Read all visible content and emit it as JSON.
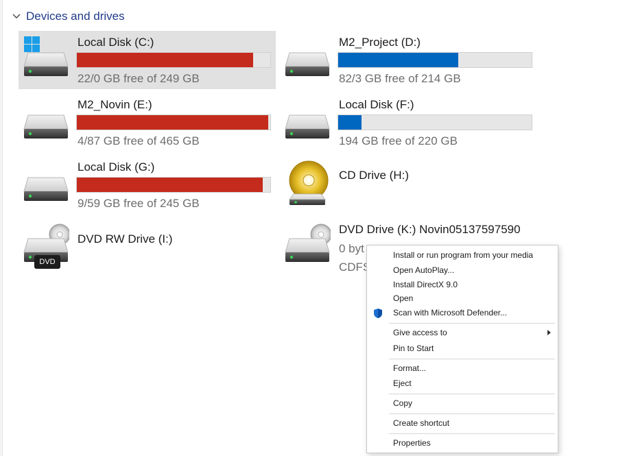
{
  "section": {
    "title": "Devices and drives",
    "chevron_icon": "chevron-down-icon"
  },
  "drives": [
    {
      "name": "Local Disk (C:)",
      "free_text": "22/0 GB free of 249 GB",
      "used_fraction": 0.91,
      "bar_color": "#c42b1c",
      "icon": "windows-drive-icon",
      "selected": true
    },
    {
      "name": "M2_Project (D:)",
      "free_text": "82/3 GB free of 214 GB",
      "used_fraction": 0.62,
      "bar_color": "#0067c0",
      "icon": "hard-drive-icon",
      "selected": false
    },
    {
      "name": "M2_Novin (E:)",
      "free_text": "4/87 GB free of 465 GB",
      "used_fraction": 0.99,
      "bar_color": "#c42b1c",
      "icon": "hard-drive-icon",
      "selected": false
    },
    {
      "name": "Local Disk (F:)",
      "free_text": "194 GB free of 220 GB",
      "used_fraction": 0.12,
      "bar_color": "#0067c0",
      "icon": "hard-drive-icon",
      "selected": false
    },
    {
      "name": "Local Disk (G:)",
      "free_text": "9/59 GB free of 245 GB",
      "used_fraction": 0.96,
      "bar_color": "#c42b1c",
      "icon": "hard-drive-icon",
      "selected": false
    },
    {
      "name": "CD Drive (H:)",
      "icon": "cd-drive-icon",
      "selected": false
    },
    {
      "name": "DVD RW Drive (I:)",
      "icon": "dvd-rw-drive-icon",
      "badge": "DVD",
      "selected": false
    },
    {
      "name": "DVD Drive (K:) Novin05137597590",
      "free_text_visible": "0 byt",
      "filesystem_visible": "CDFS",
      "icon": "dvd-drive-icon",
      "selected": false
    }
  ],
  "context_menu": {
    "items": [
      {
        "label": "Install or run program from your media"
      },
      {
        "label": "Open AutoPlay..."
      },
      {
        "label": "Install DirectX 9.0"
      },
      {
        "label": "Open"
      },
      {
        "label": "Scan with Microsoft Defender...",
        "icon": "defender-shield-icon"
      },
      {
        "label": "Give access to",
        "submenu": true
      },
      {
        "label": "Pin to Start"
      },
      {
        "label": "Format..."
      },
      {
        "label": "Eject"
      },
      {
        "label": "Copy"
      },
      {
        "label": "Create shortcut"
      },
      {
        "label": "Properties"
      }
    ]
  },
  "colors": {
    "accent_blue": "#0067c0",
    "warning_red": "#c42b1c",
    "selection_bg": "#e1e1e1",
    "header_blue": "#1f3a8a"
  }
}
